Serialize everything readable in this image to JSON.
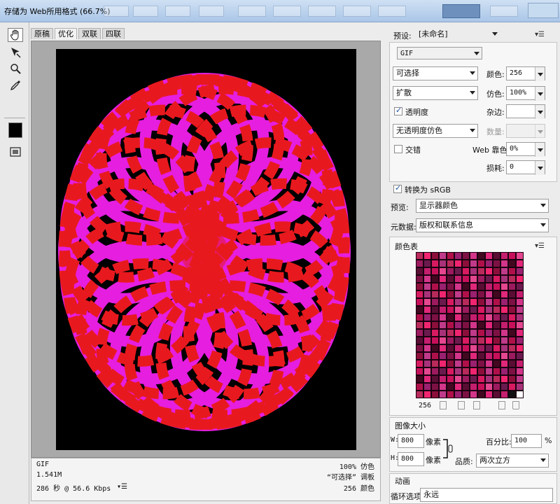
{
  "window": {
    "title": "存储为 Web所用格式 (66.7%)"
  },
  "tools": [
    {
      "icon": "hand-icon"
    },
    {
      "icon": "slice-select-icon"
    },
    {
      "icon": "zoom-icon"
    },
    {
      "icon": "eyedropper-icon"
    }
  ],
  "eyedropper_color": "#000000",
  "view_tabs": [
    "原稿",
    "优化",
    "双联",
    "四联"
  ],
  "active_tab": "优化",
  "image_info": {
    "format": "GIF",
    "size": "1.541M",
    "time": "286 秒 @ 56.6 Kbps",
    "dither_pct": "100% 仿色",
    "palette": "“可选择” 调板",
    "colors": "256 颜色"
  },
  "settings": {
    "preset_label": "预设:",
    "preset_value": "[未命名]",
    "format_value": "GIF",
    "reduction_value": "可选择",
    "colors_label": "颜色:",
    "colors_value": "256",
    "dither_algo_value": "扩散",
    "dither_label": "仿色:",
    "dither_value": "100%",
    "transparency_label": "透明度",
    "transparency_checked": true,
    "matte_label": "杂边:",
    "matte_value": "",
    "trans_dither_value": "无透明度仿色",
    "amount_label": "数量:",
    "amount_value": "",
    "interlaced_label": "交错",
    "interlaced_checked": false,
    "web_snap_label": "Web 靠色:",
    "web_snap_value": "0%",
    "lossy_label": "损耗:",
    "lossy_value": "0"
  },
  "convert_srgb_label": "转换为 sRGB",
  "convert_srgb_checked": true,
  "preview_label": "预览:",
  "preview_value": "显示器颜色",
  "metadata_label": "元数据:",
  "metadata_value": "版权和联系信息",
  "color_table": {
    "title": "颜色表",
    "count": "256"
  },
  "image_size": {
    "title": "图像大小",
    "w_label": "W:",
    "w_value": "800",
    "h_label": "H:",
    "h_value": "800",
    "unit": "像素",
    "percent_label": "百分比:",
    "percent_value": "100",
    "percent_sign": "%",
    "quality_label": "品质:",
    "quality_value": "两次立方"
  },
  "animation": {
    "title": "动画",
    "loop_label": "循环选项:",
    "loop_value": "永远"
  },
  "colors": {
    "artwork_red": "#e8191e",
    "artwork_magenta": "#e51ee0",
    "canvas_bg": "#000000"
  }
}
